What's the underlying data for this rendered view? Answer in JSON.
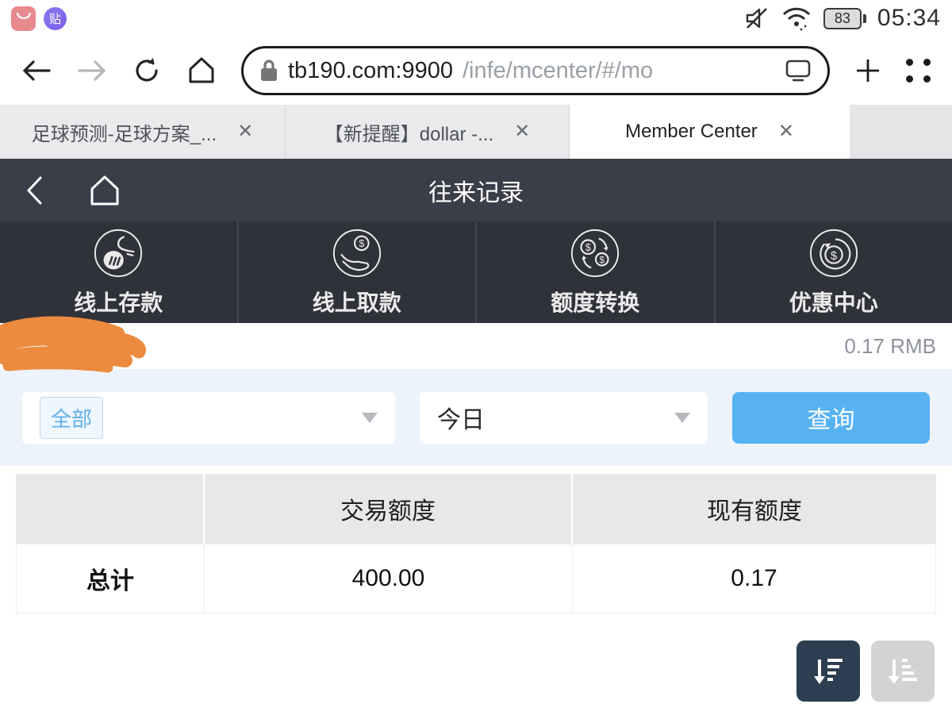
{
  "status_bar": {
    "time": "05:34",
    "battery_percent": "83",
    "tieba_glyph": "贴"
  },
  "browser": {
    "url_host": "tb190.com:9900",
    "url_path": "/infe/mcenter/#/mo"
  },
  "tabs": [
    {
      "label": "足球预测-足球方案_...",
      "close": "✕"
    },
    {
      "label": "【新提醒】dollar -...",
      "close": "✕"
    },
    {
      "label": "Member Center",
      "close": "✕"
    }
  ],
  "page_header": {
    "title": "往来记录"
  },
  "quick_nav": {
    "items": [
      {
        "label": "线上存款",
        "icon": "deposit-icon"
      },
      {
        "label": "线上取款",
        "icon": "withdraw-icon"
      },
      {
        "label": "额度转换",
        "icon": "transfer-icon"
      },
      {
        "label": "优惠中心",
        "icon": "promo-icon"
      }
    ]
  },
  "account": {
    "balance": "0.17 RMB"
  },
  "filters": {
    "type_selected_chip": "全部",
    "date_selected": "今日",
    "query_label": "查询"
  },
  "table": {
    "headers": [
      "",
      "交易额度",
      "现有额度"
    ],
    "rows": [
      [
        "总计",
        "400.00",
        "0.17"
      ]
    ]
  },
  "colors": {
    "accent_blue": "#57b2f2",
    "header_dark": "#3b3e48",
    "nav_dark": "#30323a",
    "scribble_orange": "#ec8b3f",
    "sort_dark": "#2c3e50"
  }
}
